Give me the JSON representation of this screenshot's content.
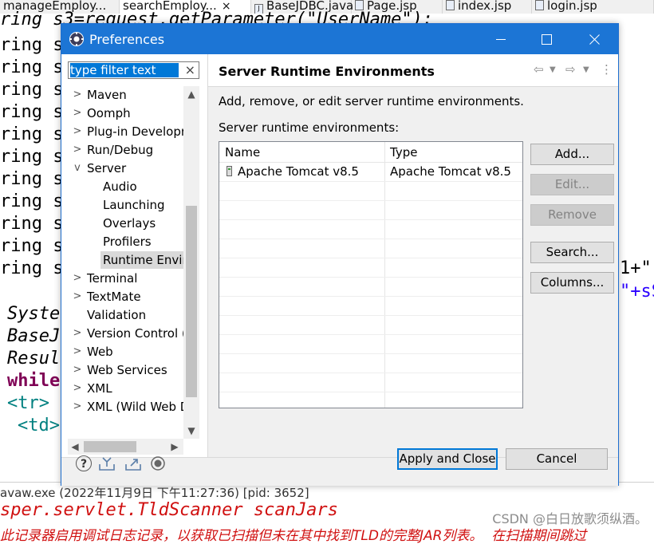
{
  "editor": {
    "tabs": [
      {
        "label": "manageEmploy...",
        "active": false,
        "icon": ""
      },
      {
        "label": "searchEmploy...",
        "active": true,
        "icon": "",
        "close": "×"
      },
      {
        "label": "BaseJDBC.java",
        "active": false,
        "icon": "J"
      },
      {
        "label": "Page.jsp",
        "active": false,
        "icon": ""
      },
      {
        "label": "index.jsp",
        "active": false,
        "icon": ""
      },
      {
        "label": "login.jsp",
        "active": false,
        "icon": ""
      }
    ],
    "top_fragment": "ring s3=request.getParameter(\"UserName\");",
    "ring_lines": [
      "ring s",
      "ring s",
      "ring s",
      "ring s",
      "ring s",
      "ring s",
      "ring s",
      "ring s",
      "ring s",
      "ring s",
      "ring s",
      "ring s"
    ],
    "syst": "Syster",
    "basej": "BaseJ",
    "result": "Resul",
    "while": "while",
    "tr": "<tr>",
    "td": "<td>",
    "right_frag_1": "1+\"",
    "right_frag_2": "\"+sS"
  },
  "console": {
    "header": "avaw.exe  (2022年11月9日 下午11:27:36) [pid: 3652]",
    "line1": "sper.servlet.TldScanner scanJars",
    "line2": "此记录器启用调试日志记录，以获取已扫描但未在其中找到TLD的完整JAR列表。  在扫描期间跳过"
  },
  "watermark": "CSDN @白日放歌须纵酒。",
  "dialog": {
    "title": "Preferences",
    "filter": {
      "value": "type filter text",
      "clear": "×"
    },
    "tree": [
      {
        "label": "Maven",
        "arrow": ">",
        "level": 0
      },
      {
        "label": "Oomph",
        "arrow": ">",
        "level": 0
      },
      {
        "label": "Plug-in Developr",
        "arrow": ">",
        "level": 0
      },
      {
        "label": "Run/Debug",
        "arrow": ">",
        "level": 0
      },
      {
        "label": "Server",
        "arrow": "v",
        "level": 0
      },
      {
        "label": "Audio",
        "arrow": "",
        "level": 1
      },
      {
        "label": "Launching",
        "arrow": "",
        "level": 1
      },
      {
        "label": "Overlays",
        "arrow": "",
        "level": 1
      },
      {
        "label": "Profilers",
        "arrow": "",
        "level": 1
      },
      {
        "label": "Runtime Envir",
        "arrow": "",
        "level": 1,
        "selected": true
      },
      {
        "label": "Terminal",
        "arrow": ">",
        "level": 0
      },
      {
        "label": "TextMate",
        "arrow": ">",
        "level": 0
      },
      {
        "label": "Validation",
        "arrow": "",
        "level": 0
      },
      {
        "label": "Version Control (",
        "arrow": ">",
        "level": 0
      },
      {
        "label": "Web",
        "arrow": ">",
        "level": 0
      },
      {
        "label": "Web Services",
        "arrow": ">",
        "level": 0
      },
      {
        "label": "XML",
        "arrow": ">",
        "level": 0
      },
      {
        "label": "XML (Wild Web D",
        "arrow": ">",
        "level": 0
      }
    ],
    "page_title": "Server Runtime Environments",
    "description": "Add, remove, or edit server runtime environments.",
    "list_label": "Server runtime environments:",
    "table": {
      "columns": [
        "Name",
        "Type"
      ],
      "rows": [
        {
          "name": "Apache Tomcat v8.5",
          "type": "Apache Tomcat v8.5"
        }
      ]
    },
    "buttons": {
      "add": "Add...",
      "edit": "Edit...",
      "remove": "Remove",
      "search": "Search...",
      "columns": "Columns...",
      "apply_close": "Apply and Close",
      "cancel": "Cancel"
    }
  }
}
